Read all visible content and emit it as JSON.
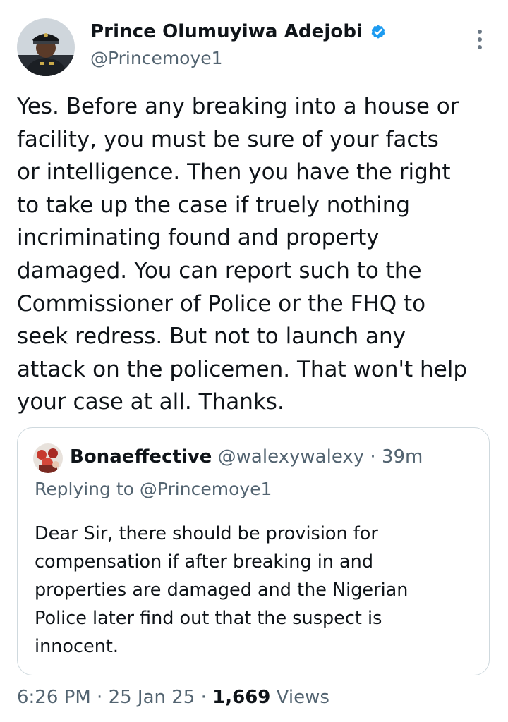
{
  "author": {
    "name": "Prince Olumuyiwa Adejobi",
    "handle": "@Princemoye1",
    "verified": true
  },
  "tweet": {
    "text": "Yes. Before any breaking into a house or\nfacility, you must be sure of your facts\nor intelligence. Then you have the right\nto take up the case if truely nothing\nincriminating found and property\ndamaged.  You can report such to the\nCommissioner of Police or the FHQ to\nseek redress.  But not to launch any\nattack on the policemen. That won't help\nyour case at all. Thanks.",
    "time": "6:26 PM",
    "date": "25 Jan 25",
    "separator": "·",
    "views_count": "1,669",
    "views_label": "Views"
  },
  "quoted_tweet": {
    "name": "Bonaeffective",
    "handle": "@walexywalexy",
    "separator": "·",
    "time": "39m",
    "replying_to": "Replying to @Princemoye1",
    "text": "Dear Sir, there should be provision for\ncompensation if after breaking in and\nproperties are damaged and the Nigerian\nPolice later find out that the suspect is\ninnocent."
  },
  "icons": {
    "verified": "verified-badge-icon",
    "more": "more-options-icon"
  },
  "colors": {
    "verified_blue": "#1d9bf0",
    "text_primary": "#0f1419",
    "text_secondary": "#536471",
    "border": "#cfd9de"
  }
}
